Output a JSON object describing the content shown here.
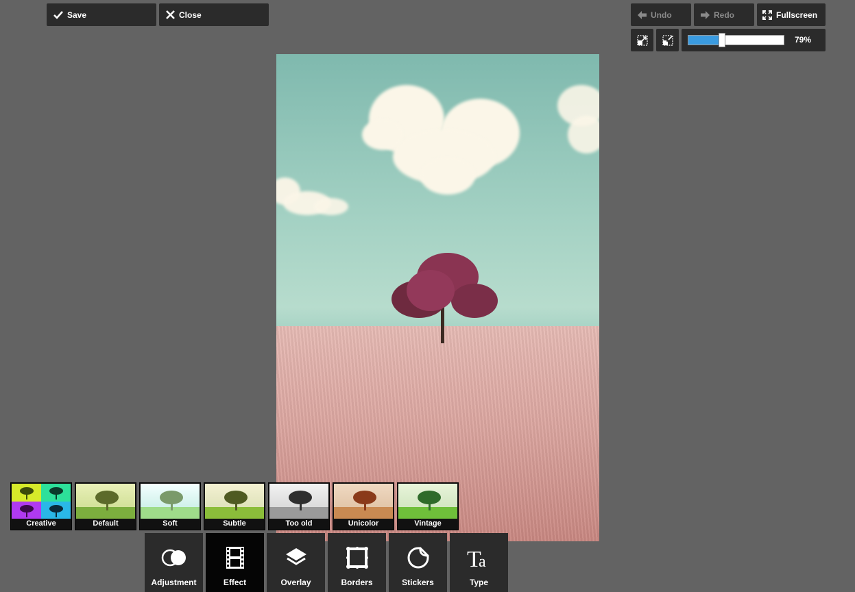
{
  "toolbar": {
    "save_label": "Save",
    "close_label": "Close",
    "undo_label": "Undo",
    "redo_label": "Redo",
    "fullscreen_label": "Fullscreen"
  },
  "zoom": {
    "value_text": "79%",
    "level_fraction": 0.35
  },
  "filters": [
    {
      "label": "Creative"
    },
    {
      "label": "Default"
    },
    {
      "label": "Soft"
    },
    {
      "label": "Subtle"
    },
    {
      "label": "Too old"
    },
    {
      "label": "Unicolor"
    },
    {
      "label": "Vintage"
    }
  ],
  "tools": [
    {
      "label": "Adjustment",
      "icon": "circles-icon"
    },
    {
      "label": "Effect",
      "icon": "film-icon"
    },
    {
      "label": "Overlay",
      "icon": "layers-icon"
    },
    {
      "label": "Borders",
      "icon": "frame-icon"
    },
    {
      "label": "Stickers",
      "icon": "sticker-icon"
    },
    {
      "label": "Type",
      "icon": "text-icon"
    }
  ],
  "colors": {
    "accent": "#3a9be0",
    "panel": "#2b2b2b",
    "background": "#636363"
  }
}
